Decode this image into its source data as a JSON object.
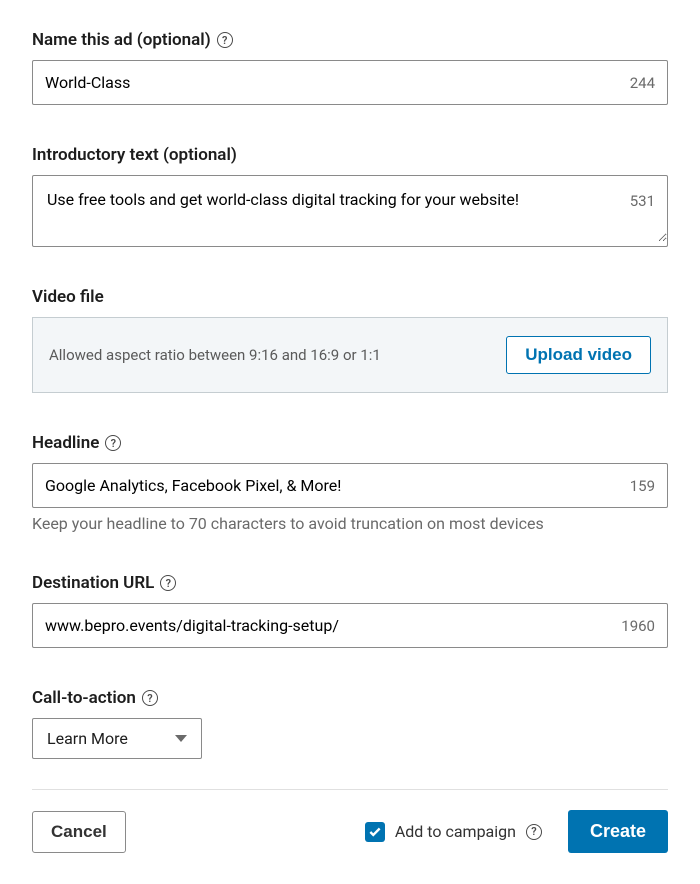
{
  "adName": {
    "label": "Name this ad (optional)",
    "value": "World-Class",
    "count": "244"
  },
  "introText": {
    "label": "Introductory text (optional)",
    "value": "Use free tools and get world-class digital tracking for your website!",
    "count": "531"
  },
  "videoFile": {
    "label": "Video file",
    "hint": "Allowed aspect ratio between 9:16 and 16:9 or 1:1",
    "buttonLabel": "Upload video"
  },
  "headline": {
    "label": "Headline",
    "value": "Google Analytics, Facebook Pixel, & More!",
    "count": "159",
    "helper": "Keep your headline to 70 characters to avoid truncation on most devices"
  },
  "destinationUrl": {
    "label": "Destination URL",
    "value": "www.bepro.events/digital-tracking-setup/",
    "count": "1960"
  },
  "cta": {
    "label": "Call-to-action",
    "value": "Learn More"
  },
  "footer": {
    "cancel": "Cancel",
    "addToCampaign": "Add to campaign",
    "create": "Create"
  }
}
